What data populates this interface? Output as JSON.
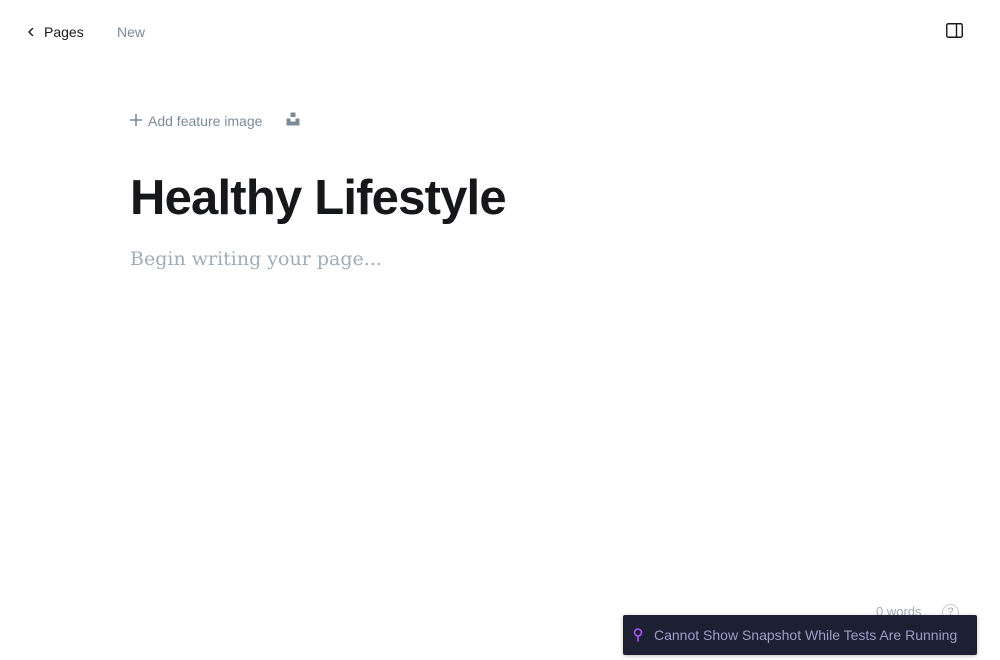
{
  "header": {
    "back_label": "Pages",
    "status": "New",
    "back_icon": "chevron-left-icon",
    "sidebar_icon": "sidebar-toggle-icon"
  },
  "editor": {
    "add_feature_image_label": "Add feature image",
    "add_icon": "plus-icon",
    "unsplash_icon": "unsplash-icon",
    "title": "Healthy Lifestyle",
    "body_placeholder": "Begin writing your page..."
  },
  "footer": {
    "word_count": "0 words",
    "help_label": "?"
  },
  "toast": {
    "icon": "pin-icon",
    "message": "Cannot Show Snapshot While Tests Are Running"
  },
  "colors": {
    "text_primary": "#15171a",
    "text_muted": "#7c8b9a",
    "placeholder": "#a1acb6",
    "toast_bg": "#1d1f33",
    "toast_icon": "#a855f7"
  }
}
